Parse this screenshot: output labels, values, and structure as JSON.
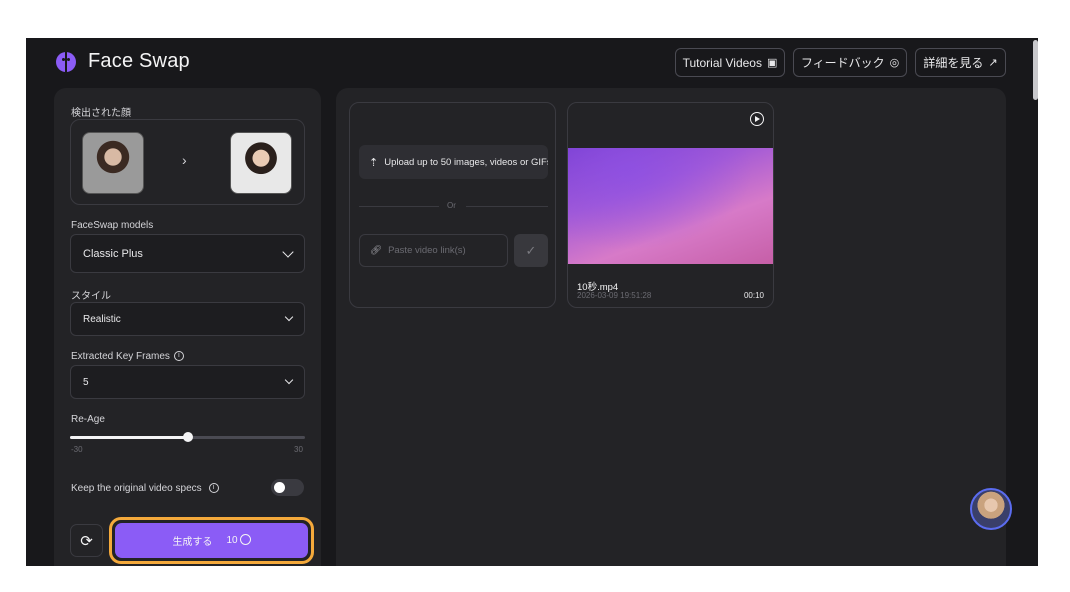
{
  "header": {
    "title": "Face Swap",
    "tutorial_label": "Tutorial Videos",
    "feedback_label": "フィードバック",
    "details_label": "詳細を見る"
  },
  "left_panel": {
    "detected_faces_label": "検出された顔",
    "models_label": "FaceSwap models",
    "models_value": "Classic Plus",
    "style_label": "スタイル",
    "style_value": "Realistic",
    "keyframes_label": "Extracted Key Frames",
    "keyframes_value": "5",
    "reage_label": "Re-Age",
    "reage_min": "-30",
    "reage_max": "30",
    "reage_value": 0,
    "keep_specs_label": "Keep the original video specs",
    "keep_specs_on": false,
    "generate_label": "生成する",
    "generate_cost": "10"
  },
  "right_panel": {
    "upload_label": "Upload up to 50 images, videos or GIFs",
    "or_label": "Or",
    "link_placeholder": "Paste video link(s)",
    "video": {
      "name": "10秒.mp4",
      "date": "2026-03-09 19:51:28",
      "duration": "00:10"
    }
  },
  "icons": {
    "logo": "face-swap-logo-icon",
    "tutorial": "video-icon",
    "feedback": "chat-icon",
    "details": "arrow-up-right-icon",
    "upload": "upload-icon",
    "link": "link-icon",
    "check": "check-icon",
    "play": "play-icon",
    "refresh": "refresh-icon",
    "coin": "coin-icon"
  },
  "colors": {
    "accent": "#8b5cf6",
    "highlight": "#f4a93b",
    "background": "#18181b",
    "panel": "#232326"
  }
}
